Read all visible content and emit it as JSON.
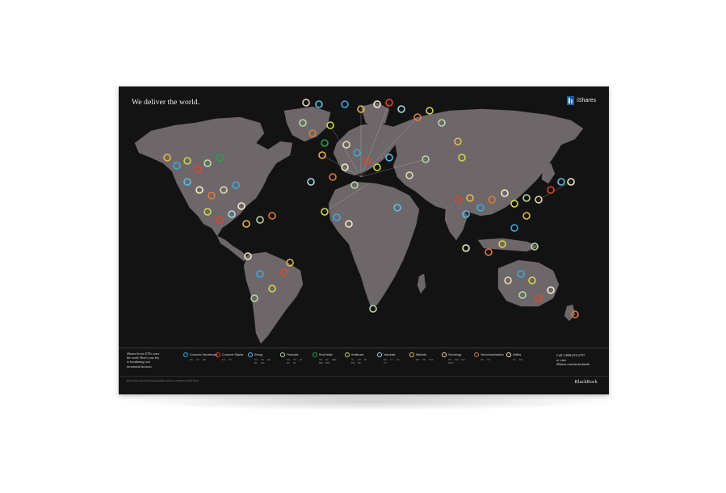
{
  "poster": {
    "headline": "We deliver the world.",
    "brand": "iShares",
    "intro_lines": [
      "iShares Sector ETFs cover",
      "the world. Here's your key",
      "to broadening your",
      "investment horizons."
    ],
    "contact": {
      "phone": "Call 1-800-474-2737",
      "or_visit": "or visit",
      "url": "iShares.com/sectorfunds"
    },
    "footnote": "Each circle represents the geographic exposure of iShares Sector ETFs.",
    "company": "BlackRock"
  },
  "legend": [
    {
      "label": "Consumer Discretionary",
      "color": "#3fa9e0",
      "tickers": [
        "IXC",
        "XLY",
        "RXI"
      ]
    },
    {
      "label": "Consumer Staples",
      "color": "#e0452d",
      "tickers": [
        "KXI",
        "IYK"
      ]
    },
    {
      "label": "Energy",
      "color": "#56c1e8",
      "tickers": [
        "IXC",
        "IYE",
        "IEO",
        "IEZ",
        "FILL"
      ]
    },
    {
      "label": "Financials",
      "color": "#b7d7a8",
      "tickers": [
        "IXG",
        "IYF",
        "IAI",
        "IAK",
        "IAT"
      ]
    },
    {
      "label": "Real Estate",
      "color": "#2e9e48",
      "tickers": [
        "IYR",
        "ICF",
        "REM",
        "REZ",
        "WPS"
      ]
    },
    {
      "label": "Healthcare",
      "color": "#d3d64a",
      "tickers": [
        "IXJ",
        "IYH",
        "IHI",
        "IHE",
        "IHF"
      ]
    },
    {
      "label": "Industrials",
      "color": "#a9d8e6",
      "tickers": [
        "EXI",
        "IYJ",
        "ITA",
        "IYT"
      ]
    },
    {
      "label": "Materials",
      "color": "#e8b84a",
      "tickers": [
        "MXI",
        "IYM",
        "PICK"
      ]
    },
    {
      "label": "Technology",
      "color": "#e8d7b0",
      "tickers": [
        "IXN",
        "IYW",
        "IGM",
        "SOXX"
      ]
    },
    {
      "label": "Telecommunications",
      "color": "#e07a3a",
      "tickers": [
        "IXP",
        "IYZ"
      ]
    },
    {
      "label": "Utilities",
      "color": "#f1ecc6",
      "tickers": [
        "JXI",
        "IDU"
      ]
    }
  ]
}
